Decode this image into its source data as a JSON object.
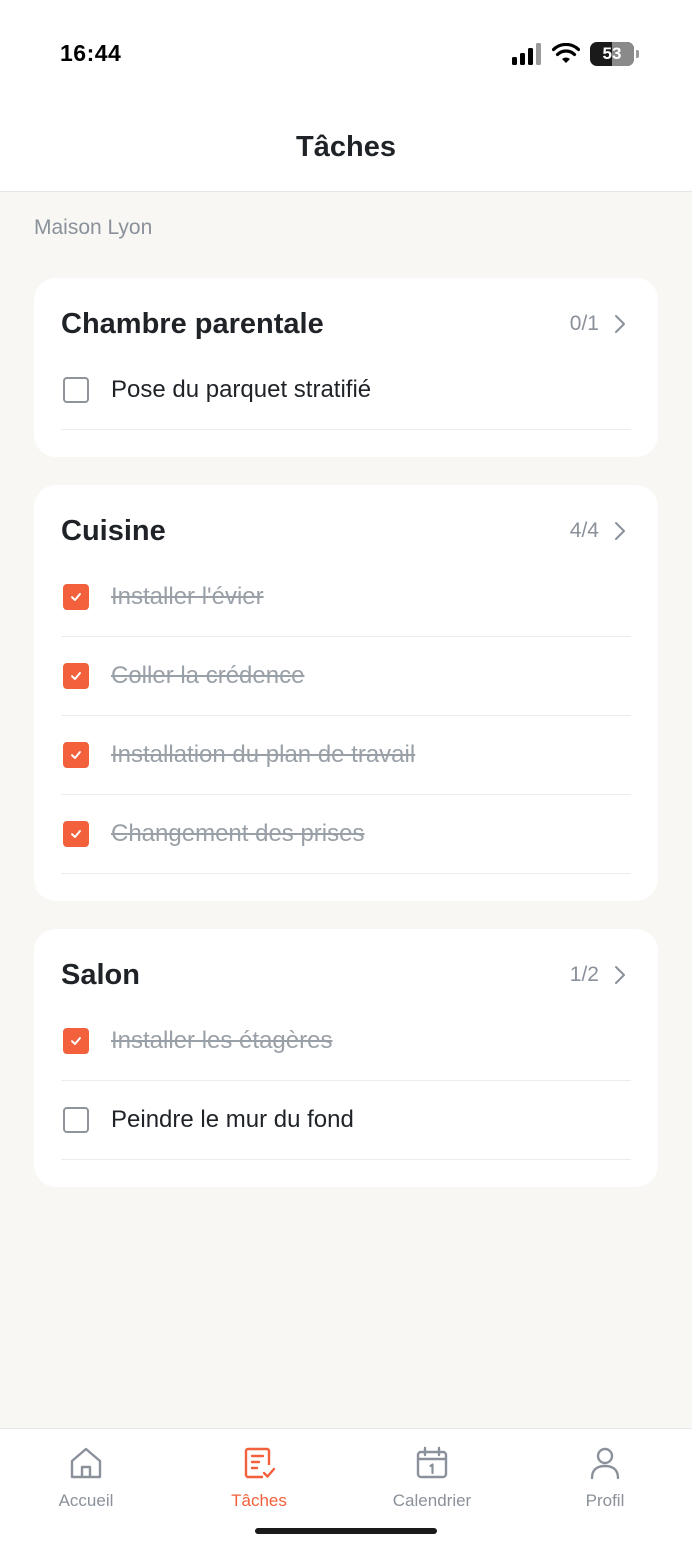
{
  "status_bar": {
    "time": "16:44",
    "battery": "53",
    "icons": [
      "signal-icon",
      "wifi-icon",
      "battery-icon"
    ]
  },
  "header": {
    "title": "Tâches"
  },
  "section_label": "Maison Lyon",
  "colors": {
    "accent": "#f2603c",
    "muted": "#8a919a",
    "background": "#f8f7f4"
  },
  "rooms": [
    {
      "name": "Chambre parentale",
      "count": "0/1",
      "tasks": [
        {
          "label": "Pose du parquet stratifié",
          "done": false
        }
      ]
    },
    {
      "name": "Cuisine",
      "count": "4/4",
      "tasks": [
        {
          "label": "Installer l'évier",
          "done": true
        },
        {
          "label": "Coller la crédence",
          "done": true
        },
        {
          "label": "Installation du plan de travail",
          "done": true
        },
        {
          "label": "Changement des prises",
          "done": true
        }
      ]
    },
    {
      "name": "Salon",
      "count": "1/2",
      "tasks": [
        {
          "label": "Installer les étagères",
          "done": true
        },
        {
          "label": "Peindre le mur du fond",
          "done": false
        }
      ]
    }
  ],
  "tabs": [
    {
      "label": "Accueil",
      "icon": "home-icon",
      "active": false
    },
    {
      "label": "Tâches",
      "icon": "tasks-icon",
      "active": true
    },
    {
      "label": "Calendrier",
      "icon": "calendar-icon",
      "active": false
    },
    {
      "label": "Profil",
      "icon": "profile-icon",
      "active": false
    }
  ]
}
